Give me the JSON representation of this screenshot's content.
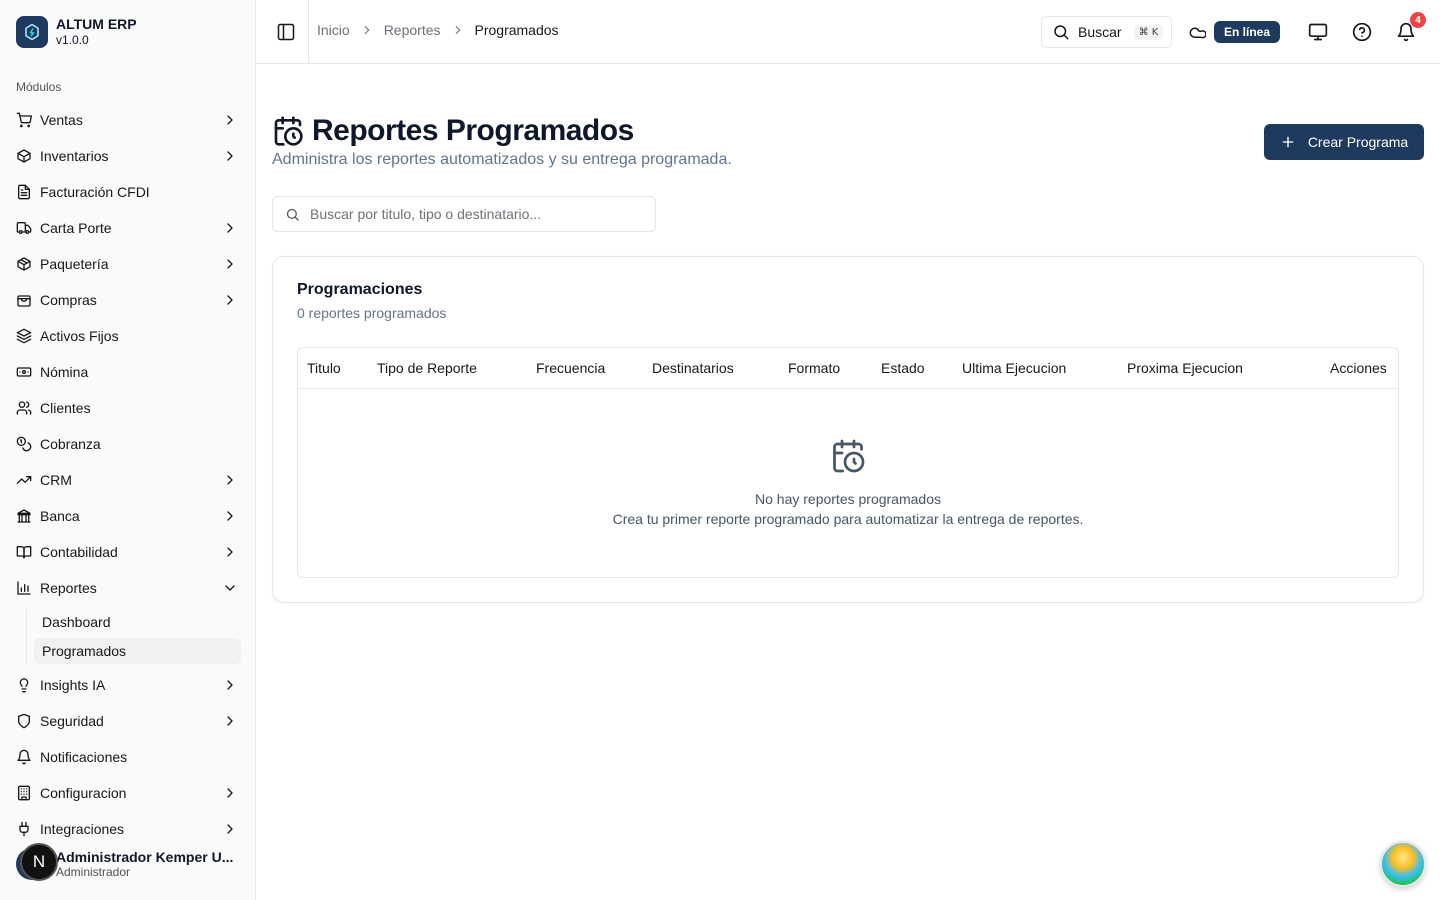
{
  "brand": {
    "name": "ALTUM ERP",
    "version": "v1.0.0",
    "color": "#1e3a5f"
  },
  "sidebar": {
    "section_label": "Módulos",
    "items": [
      {
        "label": "Ventas",
        "icon": "cart-icon",
        "chevron": "right"
      },
      {
        "label": "Inventarios",
        "icon": "box-icon",
        "chevron": "right"
      },
      {
        "label": "Facturación CFDI",
        "icon": "file-icon",
        "chevron": ""
      },
      {
        "label": "Carta Porte",
        "icon": "truck-icon",
        "chevron": "right"
      },
      {
        "label": "Paquetería",
        "icon": "package-icon",
        "chevron": "right"
      },
      {
        "label": "Compras",
        "icon": "shopping-bag-icon",
        "chevron": "right"
      },
      {
        "label": "Activos Fijos",
        "icon": "layers-icon",
        "chevron": ""
      },
      {
        "label": "Nómina",
        "icon": "banknote-icon",
        "chevron": ""
      },
      {
        "label": "Clientes",
        "icon": "users-icon",
        "chevron": ""
      },
      {
        "label": "Cobranza",
        "icon": "coins-icon",
        "chevron": ""
      },
      {
        "label": "CRM",
        "icon": "trending-up-icon",
        "chevron": "right"
      },
      {
        "label": "Banca",
        "icon": "bank-icon",
        "chevron": "right"
      },
      {
        "label": "Contabilidad",
        "icon": "book-icon",
        "chevron": "right"
      },
      {
        "label": "Reportes",
        "icon": "bar-chart-icon",
        "chevron": "down"
      }
    ],
    "reportes_sub": [
      {
        "label": "Dashboard"
      },
      {
        "label": "Programados"
      }
    ],
    "items_after": [
      {
        "label": "Insights IA",
        "icon": "lightbulb-icon",
        "chevron": "right"
      },
      {
        "label": "Seguridad",
        "icon": "shield-icon",
        "chevron": "right"
      },
      {
        "label": "Notificaciones",
        "icon": "bell-icon",
        "chevron": ""
      },
      {
        "label": "Configuracion",
        "icon": "building-icon",
        "chevron": "right"
      },
      {
        "label": "Integraciones",
        "icon": "plug-icon",
        "chevron": "right"
      }
    ]
  },
  "user": {
    "initial": "N",
    "name": "Administrador Kemper U...",
    "role": "Administrador"
  },
  "header": {
    "breadcrumb": [
      "Inicio",
      "Reportes",
      "Programados"
    ],
    "search_label": "Buscar",
    "search_shortcut": "⌘ K",
    "status": "En línea",
    "notification_count": "4"
  },
  "page": {
    "title": "Reportes Programados",
    "subtitle": "Administra los reportes automatizados y su entrega programada.",
    "create_button": "Crear Programa",
    "search_placeholder": "Buscar por titulo, tipo o destinatario..."
  },
  "card": {
    "title": "Programaciones",
    "count_text": "0 reportes programados",
    "columns": [
      "Titulo",
      "Tipo de Reporte",
      "Frecuencia",
      "Destinatarios",
      "Formato",
      "Estado",
      "Ultima Ejecucion",
      "Proxima Ejecucion",
      "Acciones"
    ],
    "empty_title": "No hay reportes programados",
    "empty_desc": "Crea tu primer reporte programado para automatizar la entrega de reportes."
  }
}
